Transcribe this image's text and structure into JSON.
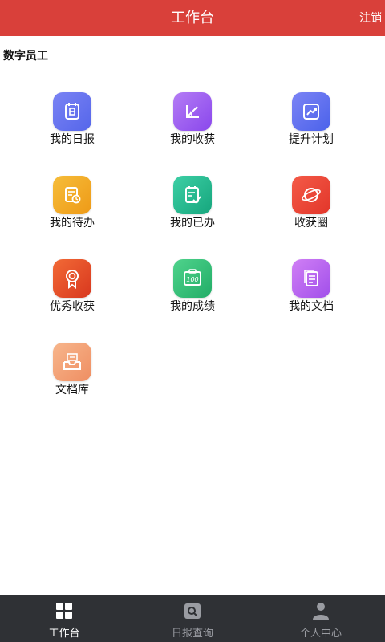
{
  "header": {
    "title": "工作台",
    "logout_label": "注销"
  },
  "section": {
    "label": "数字员工"
  },
  "grid": {
    "items": [
      {
        "label": "我的日报",
        "icon": "daily-report-icon",
        "color": "#6b76f0"
      },
      {
        "label": "我的收获",
        "icon": "harvest-icon",
        "color": "#9a5ef0"
      },
      {
        "label": "提升计划",
        "icon": "improvement-plan-icon",
        "color": "#5a6cf0"
      },
      {
        "label": "我的待办",
        "icon": "todo-icon",
        "color": "#f0a622"
      },
      {
        "label": "我的已办",
        "icon": "done-icon",
        "color": "#22b98f"
      },
      {
        "label": "收获圈",
        "icon": "harvest-circle-icon",
        "color": "#ee4535"
      },
      {
        "label": "优秀收获",
        "icon": "excellent-harvest-icon",
        "color": "#e9522a"
      },
      {
        "label": "我的成绩",
        "icon": "score-icon",
        "color": "#2fc07a"
      },
      {
        "label": "我的文档",
        "icon": "documents-icon",
        "color": "#b964ef"
      },
      {
        "label": "文档库",
        "icon": "document-library-icon",
        "color": "#f4a17a"
      }
    ]
  },
  "tabbar": {
    "tabs": [
      {
        "label": "工作台",
        "icon": "grid-icon",
        "active": true
      },
      {
        "label": "日报查询",
        "icon": "search-report-icon",
        "active": false
      },
      {
        "label": "个人中心",
        "icon": "person-icon",
        "active": false
      }
    ]
  }
}
